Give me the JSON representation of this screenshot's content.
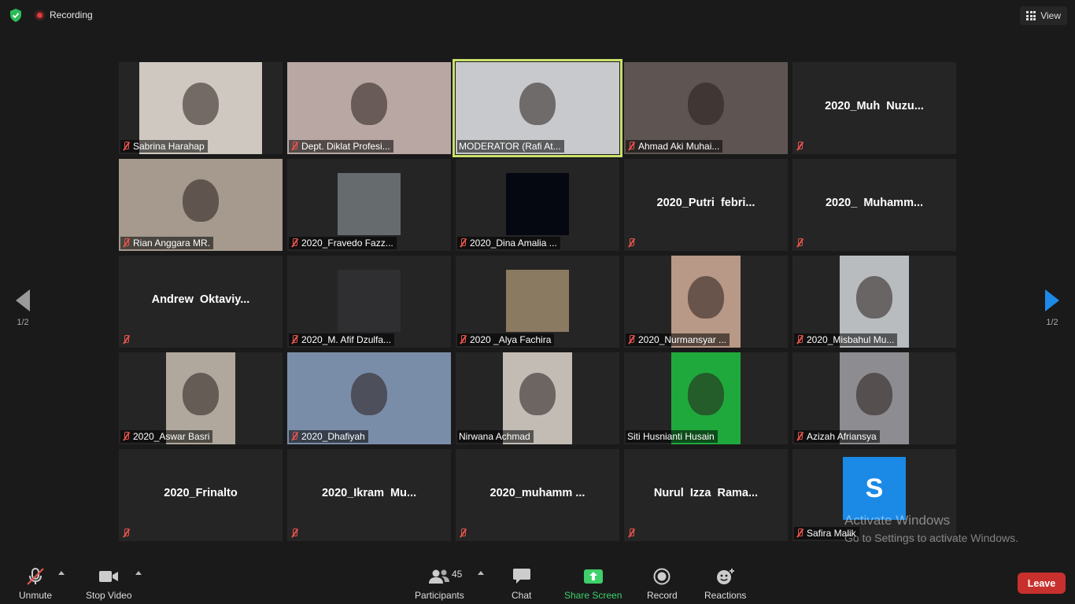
{
  "topbar": {
    "recording_label": "Recording",
    "view_label": "View"
  },
  "gallery": {
    "tiles": [
      {
        "name": "Sabrina Harahap",
        "type": "video",
        "video_color": "#cfc8c0",
        "pillar": true
      },
      {
        "name": "Dept. Diklat Profesi...",
        "type": "video",
        "video_color": "#b9a7a3",
        "pillar": false
      },
      {
        "name": "MODERATOR (Rafi At...",
        "type": "video",
        "video_color": "#c8c9cc",
        "pillar": false,
        "active": true,
        "no_mic_icon": true
      },
      {
        "name": "Ahmad Aki Muhai...",
        "type": "video",
        "video_color": "#5e5552",
        "pillar": false
      },
      {
        "name": "",
        "big_name": "2020_Muh  Nuzu...",
        "type": "name"
      },
      {
        "name": "Rian Anggara MR.",
        "type": "video",
        "video_color": "#a59a8d",
        "pillar": false
      },
      {
        "name": "2020_Fravedo Fazz...",
        "type": "video",
        "video_color": "#666b6e",
        "small": true
      },
      {
        "name": "2020_Dina Amalia ...",
        "type": "video",
        "video_color": "#050810",
        "small": true
      },
      {
        "name": "",
        "big_name": "2020_Putri  febri...",
        "type": "name"
      },
      {
        "name": "",
        "big_name": "2020_  Muhamm...",
        "type": "name"
      },
      {
        "name": "",
        "big_name": "Andrew  Oktaviy...",
        "type": "name"
      },
      {
        "name": "2020_M. Afif Dzulfa...",
        "type": "video",
        "video_color": "#2f2f31",
        "small": true
      },
      {
        "name": "2020 _Alya Fachira",
        "type": "video",
        "video_color": "#8b7a62",
        "small": true
      },
      {
        "name": "2020_Nurmansyar ...",
        "type": "video",
        "video_color": "#b89886",
        "pillar": true
      },
      {
        "name": "2020_Misbahul Mu...",
        "type": "video",
        "video_color": "#b9bcbf",
        "pillar": true
      },
      {
        "name": "2020_Aswar Basri",
        "type": "video",
        "video_color": "#b0a89c",
        "pillar": true
      },
      {
        "name": "2020_Dhafiyah",
        "type": "video",
        "video_color": "#7a8da8",
        "pillar": false
      },
      {
        "name": "Nirwana Achmad",
        "type": "video",
        "video_color": "#c2bcb5",
        "pillar": true,
        "no_mic_icon": true
      },
      {
        "name": "Siti Husnianti Husain",
        "type": "video",
        "video_color": "#1fa93c",
        "pillar": true,
        "no_mic_icon": true
      },
      {
        "name": "Azizah Afriansya",
        "type": "video",
        "video_color": "#8d8c90",
        "pillar": true
      },
      {
        "name": "",
        "big_name": "2020_Frinalto",
        "type": "name"
      },
      {
        "name": "",
        "big_name": "2020_Ikram  Mu...",
        "type": "name"
      },
      {
        "name": "",
        "big_name": "2020_muhamm ...",
        "type": "name"
      },
      {
        "name": "",
        "big_name": "Nurul  Izza  Rama...",
        "type": "name"
      },
      {
        "name": "Safira Malik",
        "type": "avatar",
        "avatar_letter": "S"
      }
    ]
  },
  "pagination": {
    "left_label": "1/2",
    "right_label": "1/2"
  },
  "watermark": {
    "line1": "Activate Windows",
    "line2": "Go to Settings to activate Windows."
  },
  "toolbar": {
    "unmute_label": "Unmute",
    "stop_video_label": "Stop Video",
    "participants_label": "Participants",
    "participants_count": "45",
    "chat_label": "Chat",
    "share_label": "Share Screen",
    "record_label": "Record",
    "reactions_label": "Reactions",
    "leave_label": "Leave"
  },
  "colors": {
    "accent_active": "#c9e06a",
    "share_green": "#3ed06b",
    "leave_red": "#c8302e",
    "mic_off_red": "#e5524c"
  }
}
